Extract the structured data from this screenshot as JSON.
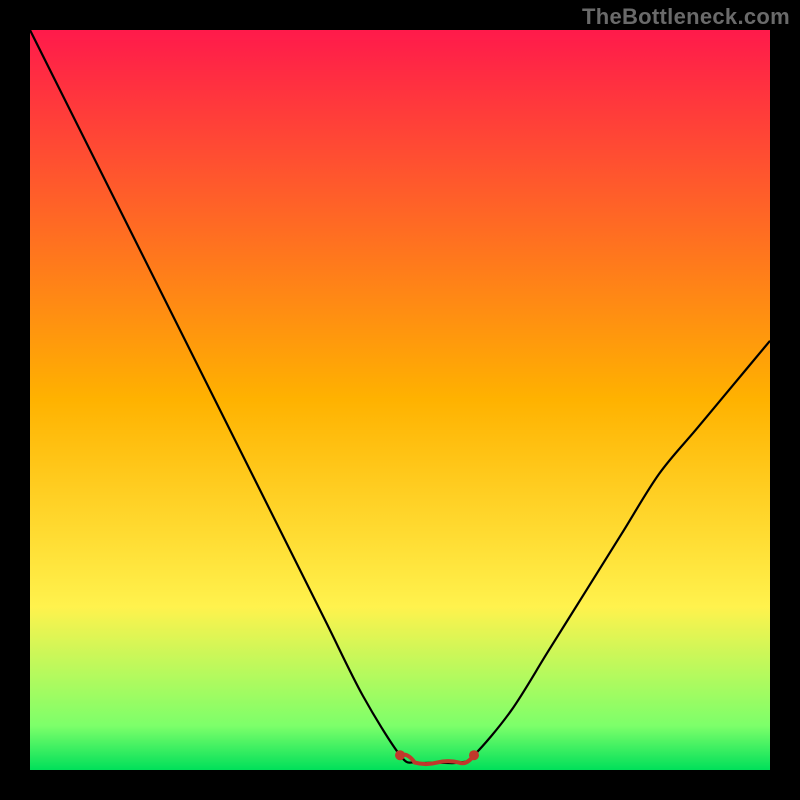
{
  "watermark": "TheBottleneck.com",
  "chart_data": {
    "type": "line",
    "title": "",
    "xlabel": "",
    "ylabel": "",
    "xlim": [
      0,
      100
    ],
    "ylim": [
      0,
      100
    ],
    "grid": false,
    "legend": false,
    "background_gradient": {
      "stops": [
        {
          "offset": 0.0,
          "color": "#ff1a4b"
        },
        {
          "offset": 0.5,
          "color": "#ffb200"
        },
        {
          "offset": 0.78,
          "color": "#fff24d"
        },
        {
          "offset": 0.94,
          "color": "#7dff6a"
        },
        {
          "offset": 1.0,
          "color": "#00e05a"
        }
      ]
    },
    "series": [
      {
        "name": "bottleneck-curve",
        "color": "#000000",
        "x": [
          0,
          5,
          10,
          15,
          20,
          25,
          30,
          35,
          40,
          45,
          50,
          52,
          55,
          58,
          60,
          65,
          70,
          75,
          80,
          85,
          90,
          95,
          100
        ],
        "y": [
          100,
          90,
          80,
          70,
          60,
          50,
          40,
          30,
          20,
          10,
          2,
          1,
          1,
          1,
          2,
          8,
          16,
          24,
          32,
          40,
          46,
          52,
          58
        ]
      },
      {
        "name": "optimal-band",
        "color": "#c0392b",
        "x": [
          50,
          52,
          55,
          58,
          60
        ],
        "y": [
          2,
          1,
          1,
          1,
          2
        ]
      }
    ],
    "annotations": []
  },
  "colors": {
    "frame": "#000000",
    "curve": "#000000",
    "marker": "#c0392b",
    "watermark": "#6a6a6a"
  }
}
